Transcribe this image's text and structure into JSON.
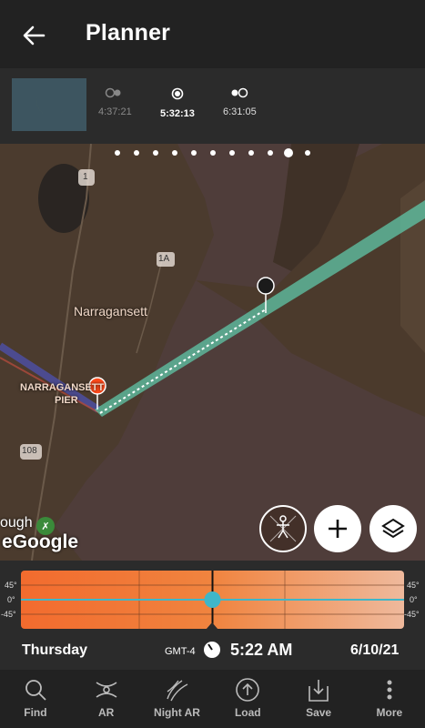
{
  "header": {
    "title": "Planner"
  },
  "phases": [
    {
      "time": "4:37:21",
      "state": "dim"
    },
    {
      "time": "5:32:13",
      "state": "active"
    },
    {
      "time": "6:31:05",
      "state": "dim"
    }
  ],
  "map": {
    "labels": {
      "town": "Narragansett",
      "pier_line1": "NARRAGANSETT",
      "pier_line2": "PIER",
      "route1": "1",
      "route1a": "1A",
      "route108": "108",
      "partial_place": "ough",
      "partial_place2": "e",
      "provider": "Google"
    }
  },
  "timeline": {
    "deg_labels": {
      "top": "45°",
      "mid": "0°",
      "bottom": "-45°"
    },
    "current_position": 0.5
  },
  "info": {
    "day": "Thursday",
    "timezone": "GMT-4",
    "time": "5:22 AM",
    "date": "6/10/21"
  },
  "nav": [
    {
      "label": "Find",
      "icon": "search-icon"
    },
    {
      "label": "AR",
      "icon": "ar-icon"
    },
    {
      "label": "Night AR",
      "icon": "night-ar-icon"
    },
    {
      "label": "Load",
      "icon": "load-icon"
    },
    {
      "label": "Save",
      "icon": "save-icon"
    },
    {
      "label": "More",
      "icon": "more-icon"
    }
  ],
  "colors": {
    "accent_orange": "#f26b2e",
    "teal": "#5fc7a8",
    "marker_red": "#ff4a1a",
    "timeline_cursor": "#3fb6c8"
  }
}
